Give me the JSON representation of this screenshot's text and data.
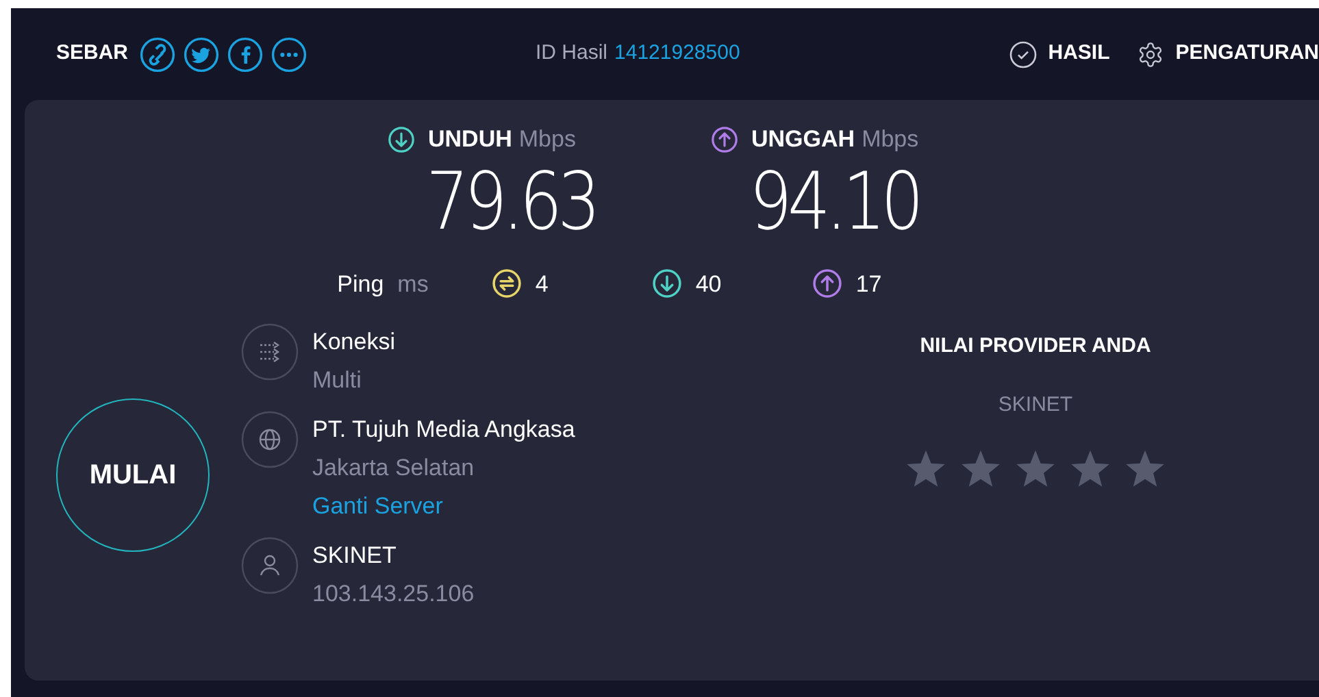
{
  "header": {
    "share_label": "SEBAR",
    "result_id_label": "ID Hasil",
    "result_id": "14121928500",
    "nav": [
      {
        "kind": "results",
        "label": "HASIL"
      },
      {
        "kind": "settings",
        "label": "PENGATURAN"
      }
    ]
  },
  "speeds": [
    {
      "kind": "download",
      "label": "UNDUH",
      "unit": "Mbps",
      "value": "79.63"
    },
    {
      "kind": "upload",
      "label": "UNGGAH",
      "unit": "Mbps",
      "value": "94.10"
    }
  ],
  "ping": {
    "label": "Ping",
    "unit": "ms",
    "readings": [
      {
        "kind": "idle",
        "value": "4"
      },
      {
        "kind": "download",
        "value": "40"
      },
      {
        "kind": "upload",
        "value": "17"
      }
    ]
  },
  "start_button": "MULAI",
  "info": [
    {
      "kind": "connection",
      "title": "Koneksi",
      "subtitle": "Multi"
    },
    {
      "kind": "server",
      "title": "PT. Tujuh Media Angkasa",
      "subtitle": "Jakarta Selatan",
      "link": "Ganti Server"
    },
    {
      "kind": "user",
      "title": "SKINET",
      "subtitle": "103.143.25.106"
    }
  ],
  "rating": {
    "title": "NILAI PROVIDER ANDA",
    "provider": "SKINET",
    "stars": 0
  }
}
